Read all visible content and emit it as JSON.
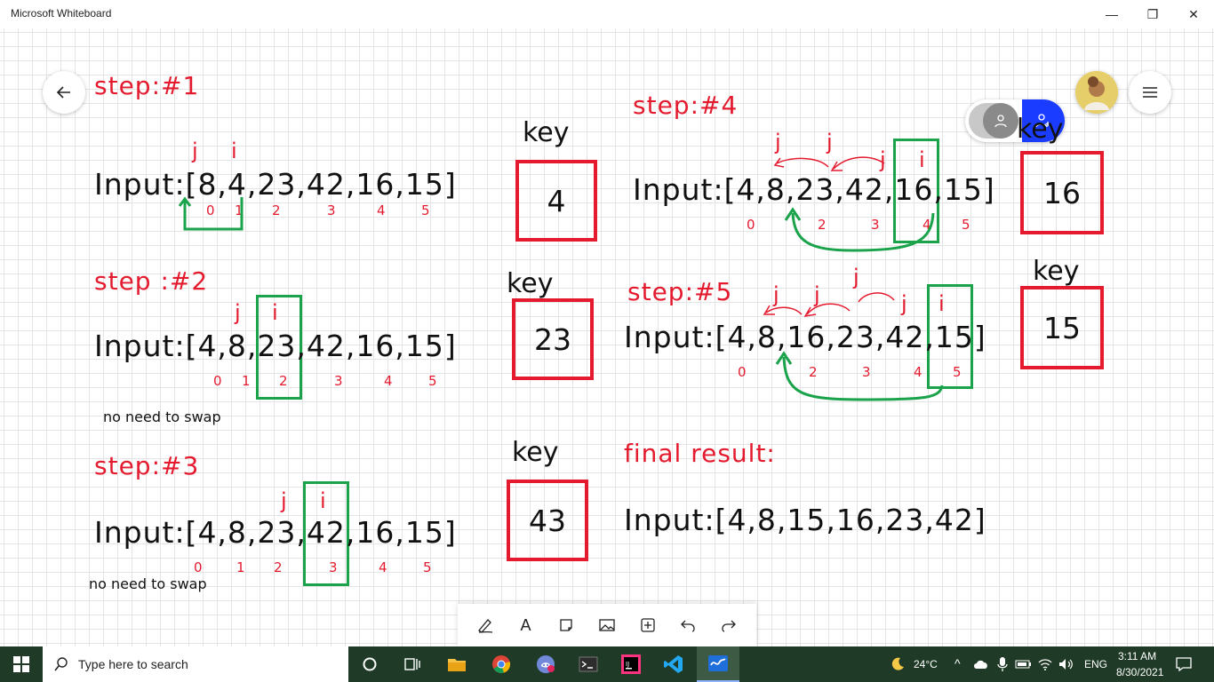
{
  "window": {
    "title": "Microsoft Whiteboard",
    "minimize": "—",
    "maximize": "❐",
    "close": "✕"
  },
  "canvas": {
    "step1": {
      "label": "step:#1",
      "input": "Input:[8,4,23,42,16,15]",
      "j": "j",
      "i": "i",
      "indices": [
        "0",
        "1",
        "2",
        "3",
        "4",
        "5"
      ],
      "key_label": "key",
      "key_value": "4"
    },
    "step2": {
      "label": "step :#2",
      "input": "Input:[4,8,23,42,16,15]",
      "j": "j",
      "i": "i",
      "indices": [
        "0",
        "1",
        "2",
        "3",
        "4",
        "5"
      ],
      "key_label": "key",
      "key_value": "23",
      "note": "no need to swap"
    },
    "step3": {
      "label": "step:#3",
      "input": "Input:[4,8,23,42,16,15]",
      "j": "j",
      "i": "i",
      "indices": [
        "0",
        "1",
        "2",
        "3",
        "4",
        "5"
      ],
      "key_label": "key",
      "key_value": "43",
      "note": "no need to swap"
    },
    "step4": {
      "label": "step:#4",
      "input": "Input:[4,8,23,42,16,15]",
      "j_labels": [
        "j",
        "j",
        "j"
      ],
      "i": "i",
      "indices": [
        "0",
        "2",
        "3",
        "4",
        "5"
      ],
      "key_label": "key",
      "key_value": "16"
    },
    "step5": {
      "label": "step:#5",
      "input": "Input:[4,8,16,23,42,15]",
      "j_labels": [
        "j",
        "j",
        "j",
        "j"
      ],
      "i": "i",
      "indices": [
        "0",
        "2",
        "3",
        "4",
        "5"
      ],
      "key_label": "key",
      "key_value": "15"
    },
    "final": {
      "label": "final result:",
      "input": "Input:[4,8,15,16,23,42]"
    }
  },
  "toolbar": {
    "tools": [
      "pen-icon",
      "text-icon",
      "note-icon",
      "image-icon",
      "insert-icon",
      "undo-icon",
      "redo-icon"
    ],
    "text_tool": "A"
  },
  "taskbar": {
    "search_placeholder": "Type here to search",
    "weather": "24°C",
    "language": "ENG",
    "time": "3:11 AM",
    "date": "8/30/2021"
  },
  "colors": {
    "ink_red": "#e41b2f",
    "ink_green": "#1aa34a",
    "accent_blue": "#1a3cff",
    "taskbar": "#1f3a26"
  }
}
